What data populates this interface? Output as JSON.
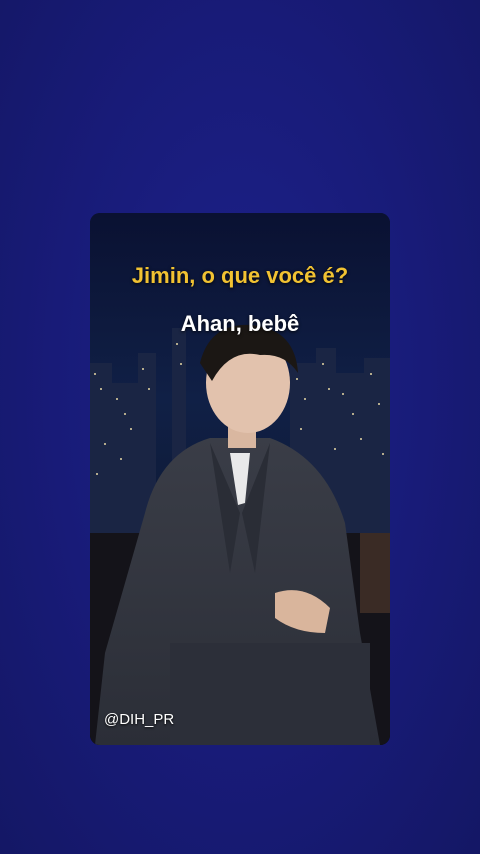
{
  "video": {
    "caption_question": "Jimin, o que você é?",
    "caption_answer": "Ahan, bebê",
    "watermark": "@DIH_PR"
  },
  "colors": {
    "page_background": "#171a72",
    "caption_question": "#f1c232",
    "caption_answer": "#ffffff"
  }
}
